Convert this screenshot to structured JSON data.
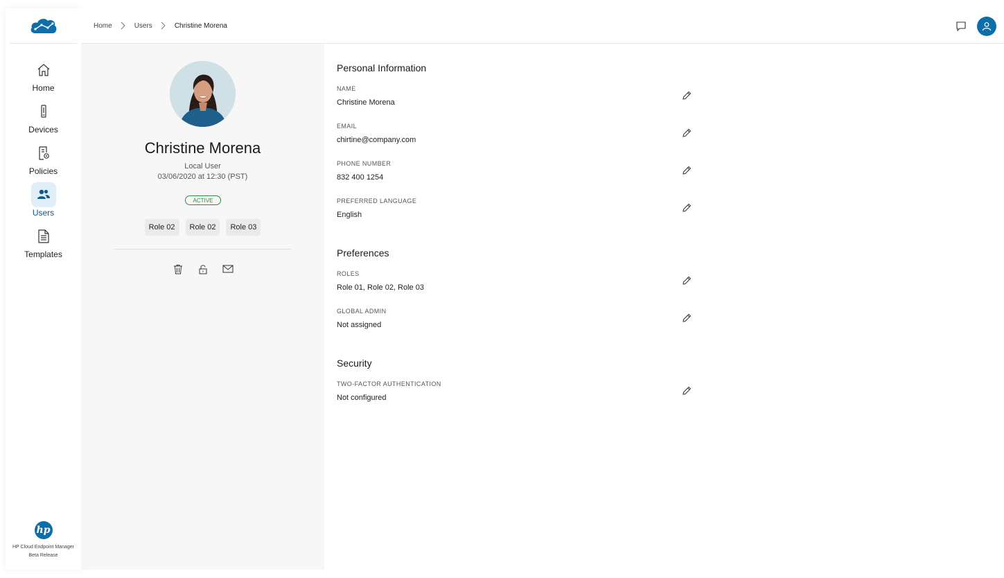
{
  "sidebar": {
    "logo_icon": "cloud-network-icon",
    "items": [
      {
        "label": "Home",
        "icon": "home-icon"
      },
      {
        "label": "Devices",
        "icon": "device-icon"
      },
      {
        "label": "Policies",
        "icon": "policy-icon"
      },
      {
        "label": "Users",
        "icon": "users-icon",
        "active": true
      },
      {
        "label": "Templates",
        "icon": "document-icon"
      }
    ],
    "brand": {
      "logo_text": "hp",
      "product": "HP Cloud Endpoint Manager",
      "release": "Beta Release"
    }
  },
  "header": {
    "breadcrumb": [
      "Home",
      "Users",
      "Christine Morena"
    ],
    "chat_icon": "chat-icon",
    "avatar_icon": "user-icon"
  },
  "profile": {
    "name": "Christine Morena",
    "type": "Local User",
    "date": "03/06/2020 at 12:30 (PST)",
    "status": "ACTIVE",
    "roles": [
      "Role 02",
      "Role 02",
      "Role 03"
    ],
    "actions": [
      "trash-icon",
      "lock-icon",
      "mail-icon"
    ]
  },
  "personal": {
    "title": "Personal Information",
    "name_label": "NAME",
    "name_value": "Christine Morena",
    "email_label": "EMAIL",
    "email_value": "chirtine@company.com",
    "phone_label": "PHONE NUMBER",
    "phone_value": "832 400 1254",
    "language_label": "PREFERRED LANGUAGE",
    "language_value": "English"
  },
  "preferences": {
    "title": "Preferences",
    "roles_label": "ROLES",
    "roles_value": "Role 01, Role 02, Role 03",
    "admin_label": "GLOBAL ADMIN",
    "admin_value": "Not assigned"
  },
  "security": {
    "title": "Security",
    "tfa_label": "TWO-FACTOR AUTHENTICATION",
    "tfa_value": "Not configured"
  },
  "colors": {
    "accent": "#0e6ea8",
    "active_nav_bg": "#dfeef7",
    "status_green": "#2e8b3e",
    "panel_bg": "#f7f7f7"
  }
}
